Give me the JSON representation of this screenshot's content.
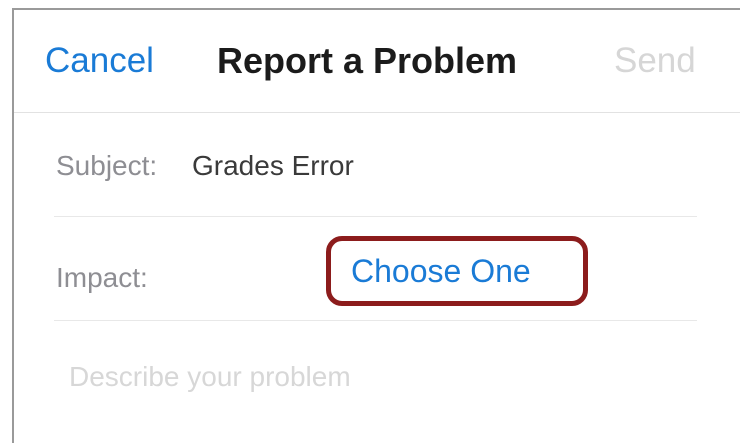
{
  "navbar": {
    "cancel_label": "Cancel",
    "title": "Report a Problem",
    "send_label": "Send"
  },
  "form": {
    "subject": {
      "label": "Subject:",
      "value": "Grades Error"
    },
    "impact": {
      "label": "Impact:",
      "choose_label": "Choose One"
    },
    "description": {
      "placeholder": "Describe your problem"
    }
  },
  "colors": {
    "link": "#1a7bd6",
    "disabled": "#d6d6d6",
    "highlight_border": "#8c1c1c"
  }
}
